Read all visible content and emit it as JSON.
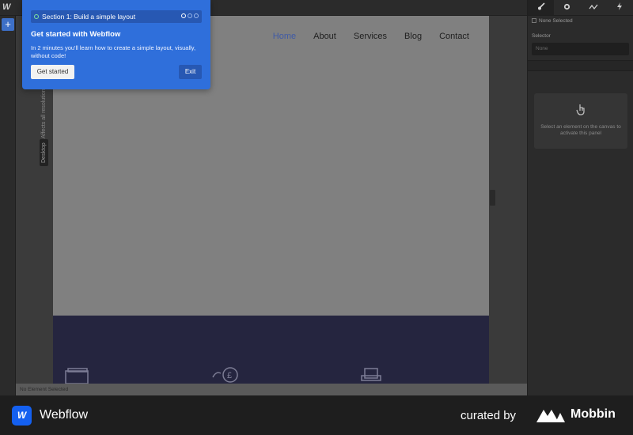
{
  "app": {
    "logo": "W"
  },
  "left_rail": {
    "add_icon": "plus-icon",
    "add_glyph": "+"
  },
  "tour": {
    "section_label": "Section 1: Build a simple layout",
    "title": "Get started with Webflow",
    "description": "In 2 minutes you'll learn how to create a simple layout, visually, without code!",
    "start_label": "Get started",
    "exit_label": "Exit",
    "steps_total": 3,
    "steps_current": 1
  },
  "canvas": {
    "device_label": "Desktop",
    "affects_label": "Affects all resolutions",
    "nav": [
      {
        "label": "Home",
        "active": true
      },
      {
        "label": "About"
      },
      {
        "label": "Services"
      },
      {
        "label": "Blog"
      },
      {
        "label": "Contact"
      }
    ],
    "footer_icons": [
      "folder-icon",
      "pound-coin-icon",
      "armchair-icon"
    ]
  },
  "status_bar": {
    "text": "No Element Selected"
  },
  "right_panel": {
    "tabs": [
      "brush-icon",
      "gear-icon",
      "interactions-icon",
      "lightning-icon"
    ],
    "none_selected": "None Selected",
    "selector_label": "Selector",
    "selector_placeholder": "None",
    "empty_message": "Select an element on the canvas to activate this panel"
  },
  "branding": {
    "app_name": "Webflow",
    "curated_by": "curated by",
    "mobbin": "Mobbin"
  }
}
